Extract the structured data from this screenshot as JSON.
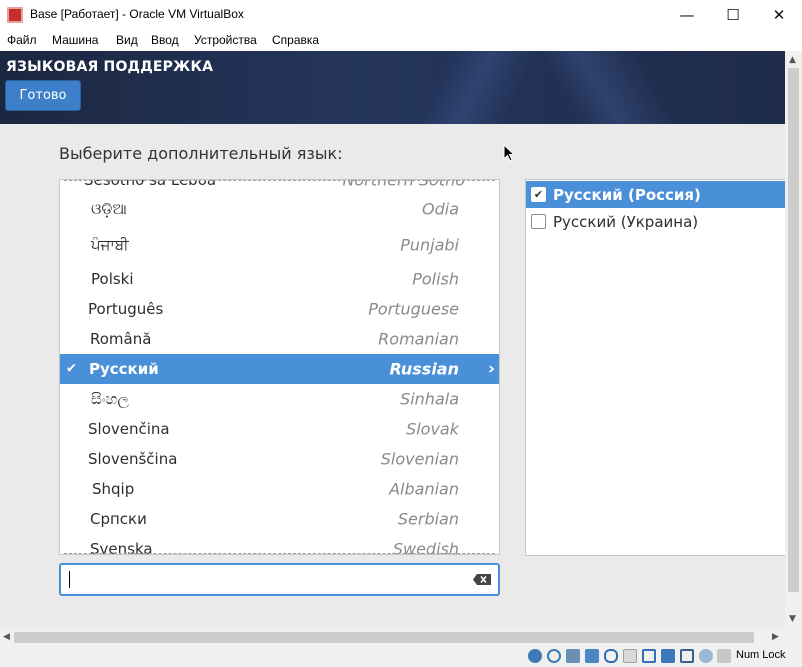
{
  "window": {
    "title": "Base [Работает] - Oracle VM VirtualBox",
    "minimize_glyph": "—",
    "maximize_glyph": "☐",
    "close_glyph": "✕"
  },
  "menu": [
    "Файл",
    "Машина",
    "Вид",
    "Ввод",
    "Устройства",
    "Справка"
  ],
  "banner": {
    "title": "ЯЗЫКОВАЯ ПОДДЕРЖКА",
    "done_label": "Готово"
  },
  "prompt": "Выберите дополнительный язык:",
  "languages": [
    {
      "native": "Sesotho sa Leboa",
      "english": "Northern Sotho",
      "partial": true
    },
    {
      "native": "ଓଡ଼ିଆ",
      "english": "Odia"
    },
    {
      "native": "ਪੰਜਾਬੀ",
      "english": "Punjabi"
    },
    {
      "native": "Polski",
      "english": "Polish"
    },
    {
      "native": "Português",
      "english": "Portuguese"
    },
    {
      "native": "Română",
      "english": "Romanian"
    },
    {
      "native": "Русский",
      "english": "Russian",
      "selected": true
    },
    {
      "native": "සිංහල",
      "english": "Sinhala"
    },
    {
      "native": "Slovenčina",
      "english": "Slovak"
    },
    {
      "native": "Slovenščina",
      "english": "Slovenian"
    },
    {
      "native": "Shqip",
      "english": "Albanian"
    },
    {
      "native": "Српски",
      "english": "Serbian"
    },
    {
      "native": "Svenska",
      "english": "Swedish"
    }
  ],
  "locales": [
    {
      "label": "Русский (Россия)",
      "checked": true,
      "selected": true
    },
    {
      "label": "Русский (Украина)",
      "checked": false,
      "selected": false
    }
  ],
  "search": {
    "value": ""
  },
  "status": {
    "numlock": "Num Lock"
  },
  "colors": {
    "accent": "#4a90d9",
    "banner": "#24355c",
    "done_button": "#3d7fc9"
  }
}
